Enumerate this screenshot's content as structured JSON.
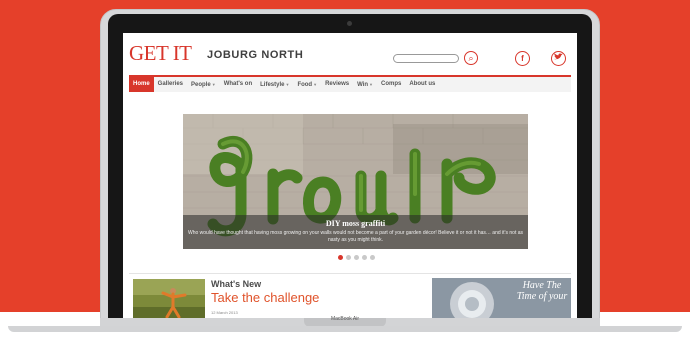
{
  "site": {
    "logo_primary": "GET IT",
    "logo_secondary": "JOBURG NORTH"
  },
  "header": {
    "search_placeholder": "",
    "facebook_label": "f",
    "twitter_label": "t"
  },
  "nav": {
    "items": [
      {
        "label": "Home",
        "has_dropdown": false,
        "active": true
      },
      {
        "label": "Galleries",
        "has_dropdown": false,
        "active": false
      },
      {
        "label": "People",
        "has_dropdown": true,
        "active": false
      },
      {
        "label": "What's on",
        "has_dropdown": false,
        "active": false
      },
      {
        "label": "Lifestyle",
        "has_dropdown": true,
        "active": false
      },
      {
        "label": "Food",
        "has_dropdown": true,
        "active": false
      },
      {
        "label": "Reviews",
        "has_dropdown": false,
        "active": false
      },
      {
        "label": "Win",
        "has_dropdown": true,
        "active": false
      },
      {
        "label": "Comps",
        "has_dropdown": false,
        "active": false
      },
      {
        "label": "About us",
        "has_dropdown": false,
        "active": false
      }
    ]
  },
  "slider": {
    "title": "DIY moss graffiti",
    "text": "Who would have thought that having moss growing on your walls would not become a part of your garden décor! Believe it or not it has… and it's not as nasty as you might think.",
    "slide_count": 5,
    "active_slide": 1
  },
  "news": {
    "section": "What's New",
    "headline": "Take the challenge",
    "date": "12 March 2013"
  },
  "ad": {
    "text": "Have The Time of your"
  },
  "device": {
    "label": "MacBook Air"
  },
  "colors": {
    "background": "#e5402a",
    "accent": "#d8362b",
    "headline": "#e0532b",
    "moss": "#3f7c1f"
  }
}
